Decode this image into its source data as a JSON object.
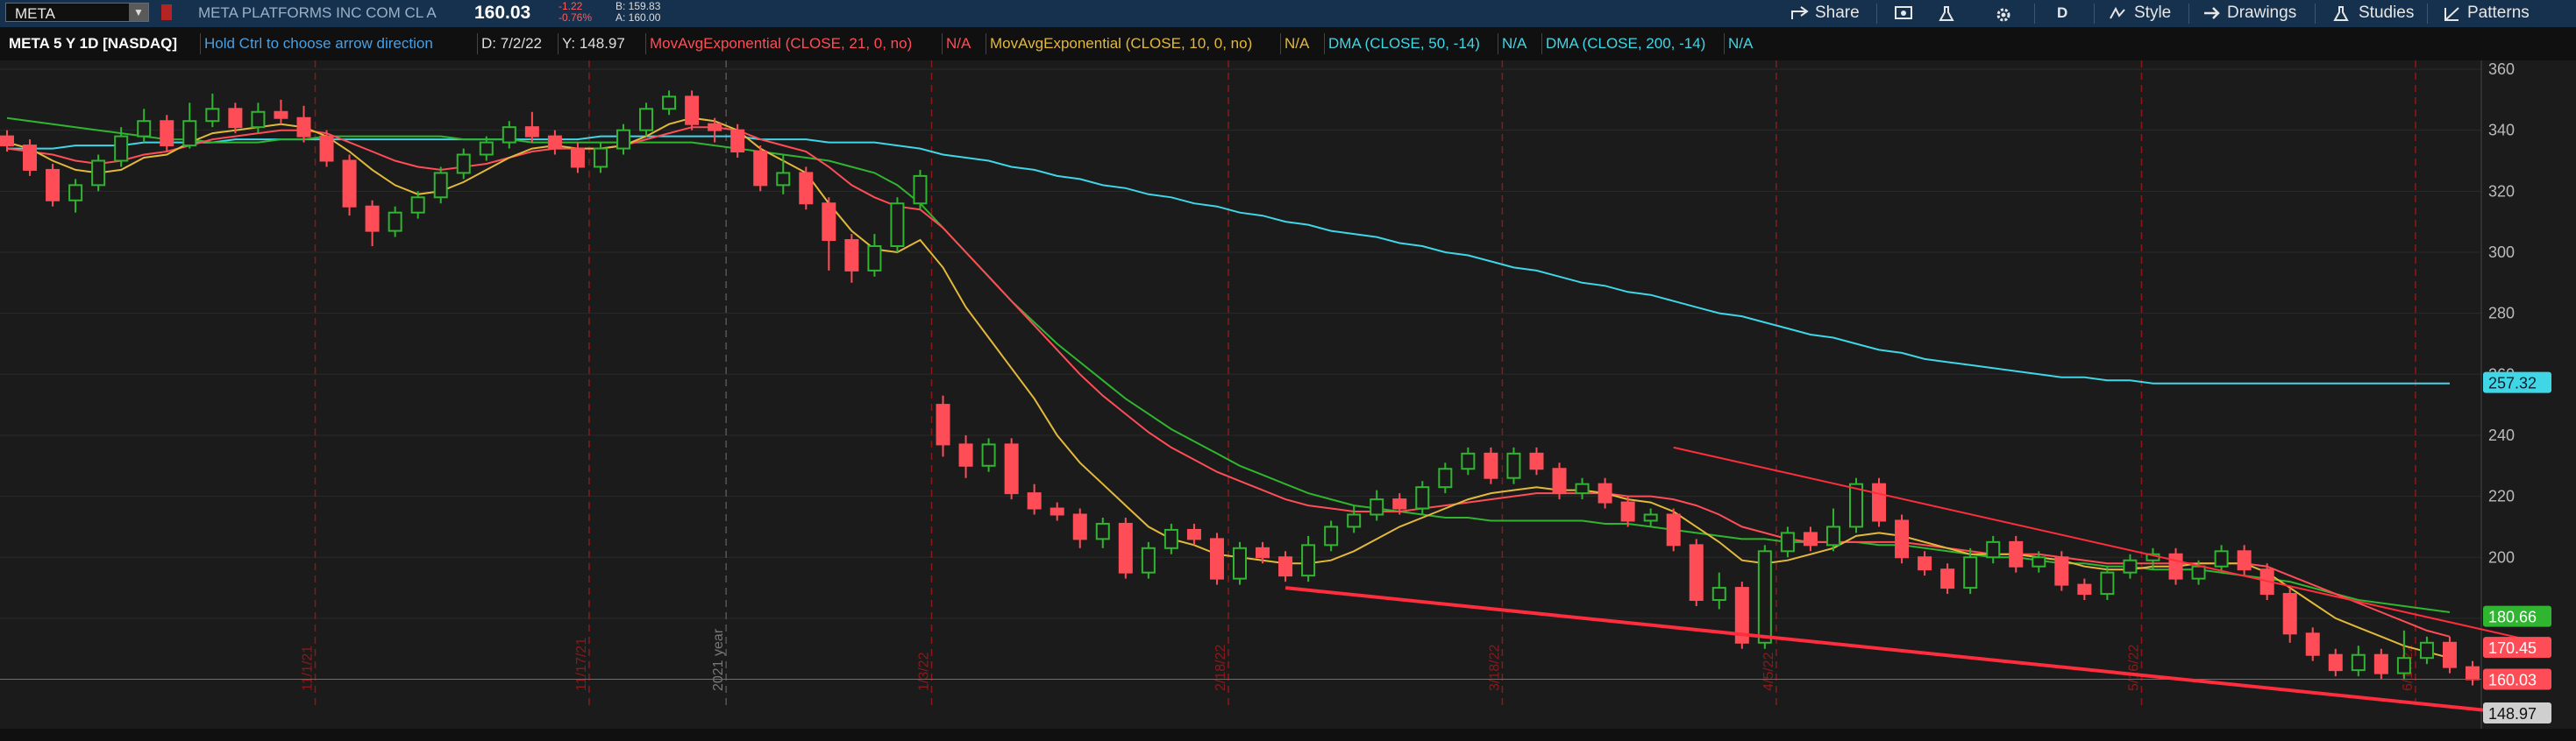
{
  "toolbar": {
    "symbol": "META",
    "company": "META PLATFORMS INC COM CL A",
    "last_price": "160.03",
    "change": "-1.22",
    "change_pct": "-0.76%",
    "bid": "B: 159.83",
    "ask": "A: 160.00",
    "share_label": "Share",
    "aggregation": "D",
    "style_label": "Style",
    "drawings_label": "Drawings",
    "studies_label": "Studies",
    "patterns_label": "Patterns"
  },
  "studybar": {
    "title": "META 5 Y 1D [NASDAQ]",
    "hint": "Hold Ctrl to choose arrow direction",
    "date": "D: 7/2/22",
    "y": "Y: 148.97",
    "studies": [
      {
        "label": "MovAvgExponential (CLOSE, 21, 0, no)",
        "value": "N/A",
        "color": "#ff4d57"
      },
      {
        "label": "MovAvgExponential (CLOSE, 10, 0, no)",
        "value": "N/A",
        "color": "#e2b93b"
      },
      {
        "label": "DMA (CLOSE, 50, -14)",
        "value": "N/A",
        "color": "#3fd6e6"
      },
      {
        "label": "DMA (CLOSE, 200, -14)",
        "value": "N/A",
        "color": "#3fd6e6"
      }
    ]
  },
  "colors": {
    "up": "#2fb52f",
    "down": "#ff4d57",
    "ema21": "#ff4d57",
    "ema10": "#e2b93b",
    "dma50": "#2fb52f",
    "dma200": "#3fd6e6",
    "trendline": "#ff2d3d",
    "background": "#1b1b1b"
  },
  "chart_data": {
    "type": "candlestick",
    "ylim": [
      147,
      362
    ],
    "y_ticks": [
      360,
      340,
      320,
      300,
      280,
      260,
      240,
      220,
      200,
      180
    ],
    "x_ticks": [
      {
        "label": "11/1/21",
        "index": 14
      },
      {
        "label": "11/17/21",
        "index": 26
      },
      {
        "label": "2021 year",
        "index": 32
      },
      {
        "label": "1/3/22",
        "index": 41
      },
      {
        "label": "2/18/22",
        "index": 54
      },
      {
        "label": "3/18/22",
        "index": 66
      },
      {
        "label": "4/5/22",
        "index": 78
      },
      {
        "label": "5/16/22",
        "index": 94
      },
      {
        "label": "6/17/22",
        "index": 106
      }
    ],
    "price_labels": [
      {
        "value": "257.32",
        "at": 257.32,
        "bg": "#3fd6e6",
        "fg": "#102030"
      },
      {
        "value": "180.66",
        "at": 180.66,
        "bg": "#2fb52f",
        "fg": "#ffffff"
      },
      {
        "value": "170.45",
        "at": 170.45,
        "bg": "#ff4d57",
        "fg": "#ffffff"
      },
      {
        "value": "160.03",
        "at": 160.03,
        "bg": "#ff4d57",
        "fg": "#ffffff"
      },
      {
        "value": "148.97",
        "at": 148.97,
        "bg": "#cfcfcf",
        "fg": "#111111"
      }
    ],
    "candles": [
      [
        338,
        335,
        340,
        333
      ],
      [
        335,
        327,
        337,
        325
      ],
      [
        327,
        317,
        329,
        315
      ],
      [
        317,
        322,
        324,
        313
      ],
      [
        322,
        330,
        332,
        320
      ],
      [
        330,
        338,
        341,
        328
      ],
      [
        338,
        343,
        347,
        336
      ],
      [
        343,
        335,
        345,
        333
      ],
      [
        335,
        343,
        349,
        334
      ],
      [
        343,
        347,
        352,
        341
      ],
      [
        347,
        341,
        349,
        339
      ],
      [
        341,
        346,
        349,
        339
      ],
      [
        346,
        344,
        350,
        342
      ],
      [
        344,
        338,
        348,
        336
      ],
      [
        338,
        330,
        340,
        328
      ],
      [
        330,
        315,
        332,
        312
      ],
      [
        315,
        307,
        317,
        302
      ],
      [
        307,
        313,
        315,
        305
      ],
      [
        313,
        318,
        320,
        311
      ],
      [
        318,
        326,
        328,
        316
      ],
      [
        326,
        332,
        334,
        324
      ],
      [
        332,
        336,
        338,
        330
      ],
      [
        336,
        341,
        343,
        334
      ],
      [
        341,
        338,
        346,
        336
      ],
      [
        338,
        334,
        340,
        332
      ],
      [
        334,
        328,
        336,
        326
      ],
      [
        328,
        334,
        336,
        326
      ],
      [
        334,
        340,
        342,
        332
      ],
      [
        340,
        347,
        349,
        338
      ],
      [
        347,
        351,
        353,
        345
      ],
      [
        351,
        342,
        353,
        340
      ],
      [
        342,
        340,
        344,
        336
      ],
      [
        340,
        333,
        342,
        331
      ],
      [
        333,
        322,
        335,
        320
      ],
      [
        322,
        326,
        332,
        319
      ],
      [
        326,
        316,
        328,
        314
      ],
      [
        316,
        304,
        318,
        294
      ],
      [
        304,
        294,
        306,
        290
      ],
      [
        294,
        302,
        306,
        292
      ],
      [
        302,
        316,
        318,
        300
      ],
      [
        316,
        325,
        327,
        314
      ],
      [
        250,
        237,
        253,
        233
      ],
      [
        237,
        230,
        240,
        226
      ],
      [
        230,
        237,
        239,
        228
      ],
      [
        237,
        221,
        239,
        219
      ],
      [
        221,
        216,
        224,
        214
      ],
      [
        216,
        214,
        218,
        212
      ],
      [
        214,
        206,
        216,
        203
      ],
      [
        206,
        211,
        213,
        203
      ],
      [
        211,
        195,
        213,
        193
      ],
      [
        195,
        203,
        205,
        193
      ],
      [
        203,
        209,
        211,
        201
      ],
      [
        209,
        206,
        211,
        204
      ],
      [
        206,
        193,
        208,
        191
      ],
      [
        193,
        203,
        205,
        191
      ],
      [
        203,
        200,
        205,
        198
      ],
      [
        200,
        194,
        202,
        192
      ],
      [
        194,
        204,
        207,
        192
      ],
      [
        204,
        210,
        212,
        202
      ],
      [
        210,
        214,
        217,
        208
      ],
      [
        214,
        219,
        222,
        212
      ],
      [
        219,
        216,
        221,
        214
      ],
      [
        216,
        223,
        225,
        214
      ],
      [
        223,
        229,
        231,
        221
      ],
      [
        229,
        234,
        236,
        227
      ],
      [
        234,
        226,
        236,
        224
      ],
      [
        226,
        234,
        236,
        224
      ],
      [
        234,
        229,
        236,
        227
      ],
      [
        229,
        221,
        231,
        219
      ],
      [
        221,
        224,
        226,
        219
      ],
      [
        224,
        218,
        226,
        216
      ],
      [
        218,
        212,
        220,
        210
      ],
      [
        212,
        214,
        216,
        210
      ],
      [
        214,
        204,
        216,
        202
      ],
      [
        204,
        186,
        206,
        184
      ],
      [
        186,
        190,
        195,
        183
      ],
      [
        190,
        172,
        192,
        170
      ],
      [
        172,
        202,
        204,
        170
      ],
      [
        202,
        208,
        210,
        200
      ],
      [
        208,
        204,
        210,
        202
      ],
      [
        204,
        210,
        216,
        202
      ],
      [
        210,
        224,
        226,
        208
      ],
      [
        224,
        212,
        226,
        210
      ],
      [
        212,
        200,
        214,
        198
      ],
      [
        200,
        196,
        202,
        194
      ],
      [
        196,
        190,
        198,
        188
      ],
      [
        190,
        200,
        203,
        188
      ],
      [
        200,
        205,
        207,
        198
      ],
      [
        205,
        197,
        207,
        195
      ],
      [
        197,
        200,
        202,
        195
      ],
      [
        200,
        191,
        202,
        189
      ],
      [
        191,
        188,
        193,
        186
      ],
      [
        188,
        195,
        197,
        186
      ],
      [
        195,
        199,
        201,
        193
      ],
      [
        199,
        201,
        203,
        196
      ],
      [
        201,
        193,
        203,
        191
      ],
      [
        193,
        197,
        199,
        191
      ],
      [
        197,
        202,
        204,
        195
      ],
      [
        202,
        196,
        204,
        194
      ],
      [
        196,
        188,
        198,
        186
      ],
      [
        188,
        175,
        190,
        172
      ],
      [
        175,
        168,
        177,
        166
      ],
      [
        168,
        163,
        170,
        161
      ],
      [
        163,
        168,
        171,
        161
      ],
      [
        168,
        162,
        170,
        160
      ],
      [
        162,
        167,
        176,
        160
      ],
      [
        167,
        172,
        174,
        165
      ],
      [
        172,
        164,
        174,
        162
      ],
      [
        164,
        160,
        166,
        158
      ]
    ],
    "ema10": [
      336,
      334,
      330,
      327,
      326,
      327,
      331,
      332,
      336,
      339,
      340,
      341,
      342,
      341,
      338,
      333,
      327,
      322,
      319,
      320,
      323,
      327,
      331,
      334,
      335,
      334,
      334,
      335,
      338,
      342,
      344,
      343,
      340,
      334,
      330,
      326,
      316,
      307,
      301,
      300,
      304,
      295,
      282,
      272,
      262,
      252,
      240,
      231,
      224,
      217,
      210,
      206,
      204,
      201,
      200,
      199,
      198,
      198,
      199,
      202,
      206,
      210,
      213,
      216,
      219,
      221,
      222,
      223,
      222,
      222,
      221,
      219,
      218,
      215,
      210,
      205,
      199,
      198,
      199,
      201,
      203,
      207,
      208,
      207,
      205,
      203,
      201,
      201,
      201,
      200,
      199,
      197,
      196,
      196,
      197,
      197,
      198,
      198,
      198,
      195,
      190,
      185,
      180,
      177,
      174,
      171,
      169,
      167
    ],
    "ema21": [
      334,
      333,
      332,
      330,
      329,
      330,
      332,
      333,
      335,
      337,
      338,
      339,
      340,
      340,
      339,
      336,
      333,
      330,
      328,
      327,
      328,
      329,
      331,
      333,
      334,
      334,
      334,
      335,
      337,
      339,
      341,
      341,
      340,
      337,
      335,
      333,
      328,
      322,
      318,
      315,
      314,
      308,
      300,
      292,
      284,
      276,
      268,
      260,
      253,
      247,
      241,
      236,
      232,
      228,
      225,
      222,
      219,
      217,
      216,
      215,
      215,
      215,
      216,
      217,
      218,
      219,
      220,
      221,
      221,
      221,
      221,
      220,
      220,
      219,
      217,
      214,
      210,
      208,
      206,
      205,
      205,
      205,
      205,
      205,
      204,
      203,
      202,
      201,
      201,
      201,
      200,
      199,
      198,
      198,
      198,
      198,
      198,
      198,
      198,
      197,
      194,
      191,
      188,
      185,
      182,
      179,
      176,
      174
    ],
    "dma50": [
      344,
      343,
      342,
      341,
      340,
      339,
      338,
      337,
      337,
      336,
      336,
      336,
      337,
      337,
      338,
      338,
      338,
      338,
      338,
      338,
      337,
      337,
      337,
      336,
      336,
      336,
      336,
      336,
      336,
      336,
      336,
      335,
      334,
      333,
      332,
      331,
      330,
      328,
      326,
      322,
      316,
      308,
      300,
      292,
      284,
      277,
      270,
      264,
      258,
      252,
      247,
      242,
      238,
      234,
      230,
      227,
      224,
      221,
      219,
      217,
      216,
      215,
      214,
      213,
      213,
      212,
      212,
      212,
      212,
      212,
      211,
      211,
      210,
      209,
      208,
      207,
      206,
      206,
      205,
      205,
      205,
      205,
      204,
      204,
      203,
      202,
      201,
      200,
      200,
      199,
      198,
      198,
      197,
      197,
      196,
      196,
      196,
      195,
      194,
      193,
      192,
      190,
      188,
      186,
      185,
      184,
      183,
      182
    ],
    "dma200": [
      334,
      334,
      334,
      335,
      335,
      335,
      336,
      336,
      336,
      336,
      337,
      337,
      337,
      337,
      337,
      337,
      337,
      337,
      337,
      337,
      337,
      337,
      337,
      337,
      337,
      337,
      338,
      338,
      338,
      338,
      338,
      338,
      338,
      337,
      337,
      337,
      336,
      336,
      336,
      335,
      334,
      332,
      331,
      330,
      328,
      327,
      325,
      324,
      322,
      321,
      319,
      318,
      316,
      315,
      313,
      312,
      310,
      309,
      307,
      306,
      305,
      303,
      302,
      300,
      299,
      297,
      295,
      294,
      292,
      290,
      289,
      287,
      286,
      284,
      282,
      280,
      279,
      277,
      275,
      273,
      272,
      270,
      268,
      267,
      265,
      264,
      263,
      262,
      261,
      260,
      259,
      259,
      258,
      258,
      257,
      257,
      257,
      257,
      257,
      257,
      257,
      257,
      257,
      257,
      257,
      257,
      257,
      257
    ],
    "trendlines": [
      {
        "from": [
          56,
          190
        ],
        "to": [
          111,
          148
        ]
      },
      {
        "from": [
          73,
          236
        ],
        "to": [
          111,
          172
        ]
      }
    ],
    "hlines": [
      160.03
    ]
  }
}
